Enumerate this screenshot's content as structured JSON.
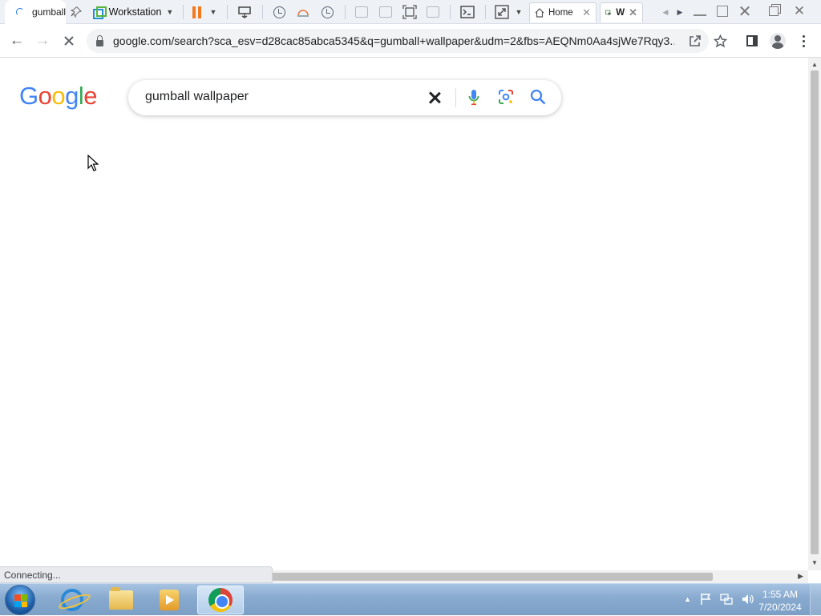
{
  "vm_toolbar": {
    "chrome_tab_title": "gumball",
    "workstation_label": "Workstation",
    "home_tab_label": "Home",
    "active_tab_label": "W"
  },
  "browser": {
    "url": "google.com/search?sca_esv=d28cac85abca5345&q=gumball+wallpaper&udm=2&fbs=AEQNm0Aa4sjWe7Rqy3..."
  },
  "google": {
    "logo_letters": [
      {
        "char": "G",
        "color": "#4285f4"
      },
      {
        "char": "o",
        "color": "#ea4335"
      },
      {
        "char": "o",
        "color": "#fbbc05"
      },
      {
        "char": "g",
        "color": "#4285f4"
      },
      {
        "char": "l",
        "color": "#34a853"
      },
      {
        "char": "e",
        "color": "#ea4335"
      }
    ],
    "search_query": "gumball wallpaper"
  },
  "status_bar": {
    "text": "Connecting..."
  },
  "taskbar": {
    "time": "1:55 AM",
    "date": "7/20/2024"
  }
}
